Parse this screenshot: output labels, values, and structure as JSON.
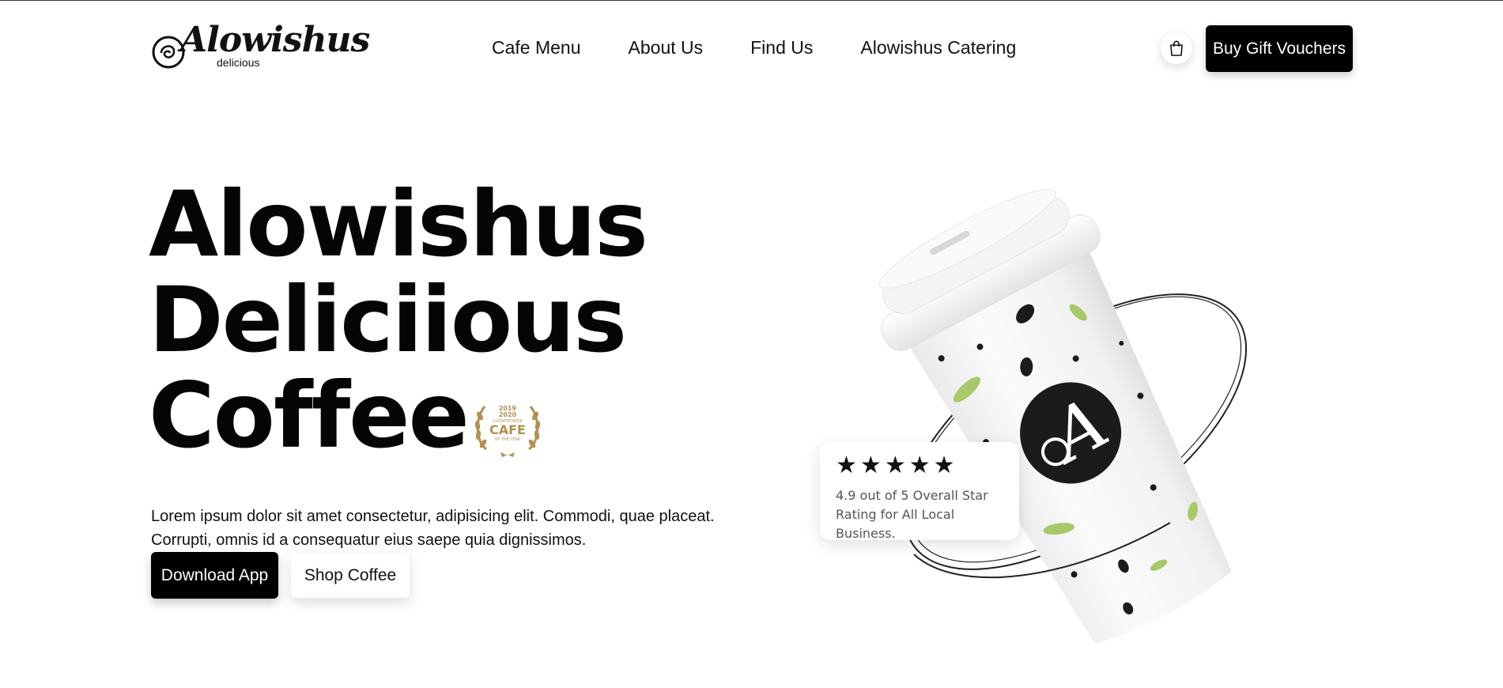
{
  "brand": {
    "logo_script": "Alowishus",
    "logo_sub": "delicious"
  },
  "nav": {
    "items": [
      {
        "label": "Cafe Menu"
      },
      {
        "label": "About Us"
      },
      {
        "label": "Find Us"
      },
      {
        "label": "Alowishus Catering"
      }
    ]
  },
  "header": {
    "cart_icon": "shopping-bag-icon",
    "voucher_button": "Buy Gift Vouchers"
  },
  "hero": {
    "title_lines": [
      "Alowishus",
      "Deliciious",
      "Coffee"
    ],
    "award_badge": {
      "years": "2019",
      "years2": "2020",
      "small": "COUNTRYWIDE",
      "main": "CAFE",
      "bottom": "OF THE YEAR"
    },
    "description": "Lorem ipsum dolor sit amet consectetur, adipisicing elit. Commodi, quae placeat. Corrupti, omnis id a consequatur eius saepe quia dignissimos.",
    "download_button": "Download App",
    "shop_button": "Shop Coffee"
  },
  "rating": {
    "stars": 5,
    "star_glyph": "★",
    "text": "4.9 out of 5 Overall Star Rating for All Local Business."
  },
  "colors": {
    "primary": "#000000",
    "background": "#ffffff",
    "gold": "#b3904f",
    "leaf_green": "#a7c96a"
  }
}
